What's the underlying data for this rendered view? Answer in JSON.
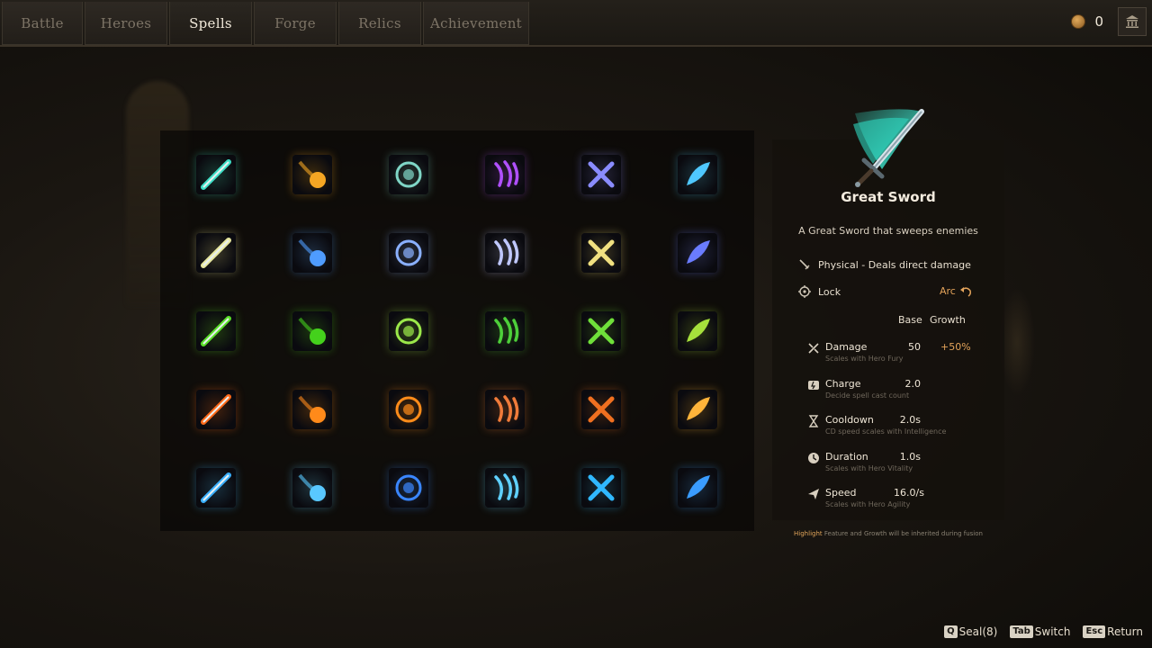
{
  "nav": {
    "tabs": [
      {
        "label": "Battle"
      },
      {
        "label": "Heroes"
      },
      {
        "label": "Spells"
      },
      {
        "label": "Forge"
      },
      {
        "label": "Relics"
      },
      {
        "label": "Achievement"
      }
    ],
    "active_tab": "Spells",
    "coins": "0"
  },
  "spells": [
    {
      "icon": "great-sword",
      "color": "#3fe0c8"
    },
    {
      "icon": "fireball-comet",
      "color": "#f5a623"
    },
    {
      "icon": "rune-shield",
      "color": "#7fd6c6"
    },
    {
      "icon": "arcane-claws",
      "color": "#b050ff"
    },
    {
      "icon": "cross-slash",
      "color": "#8a8cff"
    },
    {
      "icon": "cyan-feather",
      "color": "#4fc8ff"
    },
    {
      "icon": "lightning-storm",
      "color": "#e8e8a0"
    },
    {
      "icon": "thunder-hammer",
      "color": "#4f9cff"
    },
    {
      "icon": "wind-crescent",
      "color": "#8ab0ff"
    },
    {
      "icon": "spirit-wings",
      "color": "#c0c8ff"
    },
    {
      "icon": "cyclone",
      "color": "#f0e080"
    },
    {
      "icon": "crystal-orb",
      "color": "#6a7cff"
    },
    {
      "icon": "poison-swirl",
      "color": "#5be02a"
    },
    {
      "icon": "acid-orb",
      "color": "#44d11c"
    },
    {
      "icon": "leaf-blade",
      "color": "#9be84a"
    },
    {
      "icon": "cobra",
      "color": "#4dcf3a"
    },
    {
      "icon": "nature-leaf",
      "color": "#6fe03a"
    },
    {
      "icon": "thorn-vines",
      "color": "#a6e03c"
    },
    {
      "icon": "flame-bolt",
      "color": "#ff6a1a"
    },
    {
      "icon": "flame-wave",
      "color": "#ff8a1a"
    },
    {
      "icon": "inferno",
      "color": "#ff8c1a"
    },
    {
      "icon": "fire-roots",
      "color": "#f07b3a"
    },
    {
      "icon": "lava-orb",
      "color": "#f07020"
    },
    {
      "icon": "flame-slash",
      "color": "#ffb43a"
    },
    {
      "icon": "ice-comet",
      "color": "#3ab0ff"
    },
    {
      "icon": "frost-axe",
      "color": "#59c8ff"
    },
    {
      "icon": "ice-shards",
      "color": "#3a86ff"
    },
    {
      "icon": "frost-trail",
      "color": "#5fd0ff"
    },
    {
      "icon": "frost-bat",
      "color": "#30b8ff"
    },
    {
      "icon": "ice-burst",
      "color": "#3a9cff"
    }
  ],
  "detail": {
    "name": "Great Sword",
    "description": "A Great Sword that sweeps enemies",
    "type_line": "Physical - Deals direct damage",
    "lock_label": "Lock",
    "lock_value": "Arc",
    "col_base": "Base",
    "col_growth": "Growth",
    "stats": [
      {
        "icon": "damage-icon",
        "name": "Damage",
        "desc": "Scales with Hero Fury",
        "base": "50",
        "growth": "+50%"
      },
      {
        "icon": "charge-icon",
        "name": "Charge",
        "desc": "Decide spell cast count",
        "base": "2.0",
        "growth": ""
      },
      {
        "icon": "cooldown-icon",
        "name": "Cooldown",
        "desc": "CD speed scales with Intelligence",
        "base": "2.0s",
        "growth": ""
      },
      {
        "icon": "duration-icon",
        "name": "Duration",
        "desc": "Scales with Hero Vitality",
        "base": "1.0s",
        "growth": ""
      },
      {
        "icon": "speed-icon",
        "name": "Speed",
        "desc": "Scales with Hero Agility",
        "base": "16.0/s",
        "growth": ""
      }
    ],
    "footnote_highlight": "Highlight",
    "footnote_rest": "Feature and Growth will be inherited during fusion"
  },
  "hints": [
    {
      "key": "Q",
      "label": "Seal(8)"
    },
    {
      "key": "Tab",
      "label": "Switch"
    },
    {
      "key": "Esc",
      "label": "Return"
    }
  ]
}
